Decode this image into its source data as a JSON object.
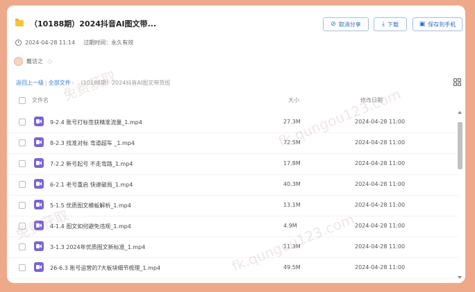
{
  "header": {
    "title": "（10188期）2024抖音AI图文带...",
    "date": "2024-04-28 11:14",
    "expire_label": "过期时间：",
    "expire_value": "永久有效",
    "owner": "戴访之"
  },
  "actions": {
    "cancel_share": "取消分享",
    "download": "下载",
    "save_to_phone": "保存到手机"
  },
  "breadcrumb": {
    "back": "返回上一级",
    "all_files": "全部文件",
    "current": "（10188期）2024抖音AI图文带货班"
  },
  "table": {
    "col_name": "文件名",
    "col_size": "大小",
    "col_date": "修改日期",
    "rows": [
      {
        "name": "9-2.4 账号打标签获精准流量_1.mp4",
        "size": "27.3M",
        "date": "2024-04-28 11:00"
      },
      {
        "name": "8-2.3 找准对标 弯道超车 _1.mp4",
        "size": "72.5M",
        "date": "2024-04-28 11:00"
      },
      {
        "name": "7-2.2 新号起号 不走弯路_1.mp4",
        "size": "17.8M",
        "date": "2024-04-28 11:00"
      },
      {
        "name": "6-2.1 老号重启 快速破局_1.mp4",
        "size": "40.3M",
        "date": "2024-04-28 11:00"
      },
      {
        "name": "5-1.5 优质图文模板解析_1.mp4",
        "size": "13.1M",
        "date": "2024-04-28 11:00"
      },
      {
        "name": "4-1.4 图文如何避免违规_1.mp4",
        "size": "4.9M",
        "date": "2024-04-28 11:00"
      },
      {
        "name": "3-1.3 2024年优质图文新标准_1.mp4",
        "size": "11.3M",
        "date": "2024-04-28 11:00"
      },
      {
        "name": "26-6.3 账号运营的7大板块细节梳理_1.mp4",
        "size": "49.5M",
        "date": "2024-04-28 11:00"
      }
    ]
  },
  "watermarks": [
    "免费获取",
    "fk.qungou123.com",
    "免费获取",
    "fk.qungou123.com"
  ],
  "colors": {
    "background": "#eea98a",
    "accent": "#2c6dbf",
    "video_icon": "#7a63d6",
    "folder": "#f5c242"
  }
}
